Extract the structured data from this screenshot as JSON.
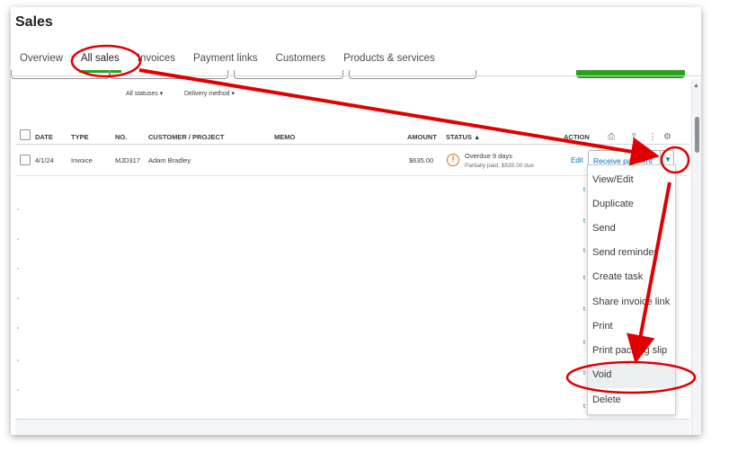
{
  "page": {
    "title": "Sales"
  },
  "tabs": [
    {
      "label": "Overview"
    },
    {
      "label": "All sales"
    },
    {
      "label": "Invoices"
    },
    {
      "label": "Payment links"
    },
    {
      "label": "Customers"
    },
    {
      "label": "Products & services"
    }
  ],
  "filters": {
    "statuses": "All statuses",
    "delivery": "Delivery method"
  },
  "table": {
    "headers": {
      "date": "DATE",
      "type": "TYPE",
      "no": "NO.",
      "customer": "CUSTOMER / PROJECT",
      "memo": "MEMO",
      "amount": "AMOUNT",
      "status": "STATUS ▲",
      "action": "ACTION"
    },
    "rows": [
      {
        "date": "4/1/24",
        "type": "Invoice",
        "no": "MJD317",
        "customer": "Adam Bradley",
        "memo": "",
        "amount": "$635.00",
        "status": "Overdue 9 days",
        "status_detail": "Partially paid, $535.00 due",
        "edit": "Edit",
        "primary_action": "Receive payment"
      }
    ]
  },
  "menu": {
    "items": [
      {
        "label": "View/Edit"
      },
      {
        "label": "Duplicate"
      },
      {
        "label": "Send"
      },
      {
        "label": "Send reminder"
      },
      {
        "label": "Create task"
      },
      {
        "label": "Share invoice link"
      },
      {
        "label": "Print"
      },
      {
        "label": "Print packing slip"
      },
      {
        "label": "Void"
      },
      {
        "label": "Delete"
      }
    ],
    "highlighted": "Void"
  },
  "icons": {
    "print": "printer-icon",
    "export": "export-icon",
    "more": "more-vertical-icon",
    "settings": "gear-icon",
    "warning": "warning-icon",
    "caret": "caret-down-icon"
  },
  "colors": {
    "accent_green": "#2ca01c",
    "link_blue": "#0077c5",
    "warning_orange": "#e96b00",
    "annotation_red": "#e00000"
  }
}
